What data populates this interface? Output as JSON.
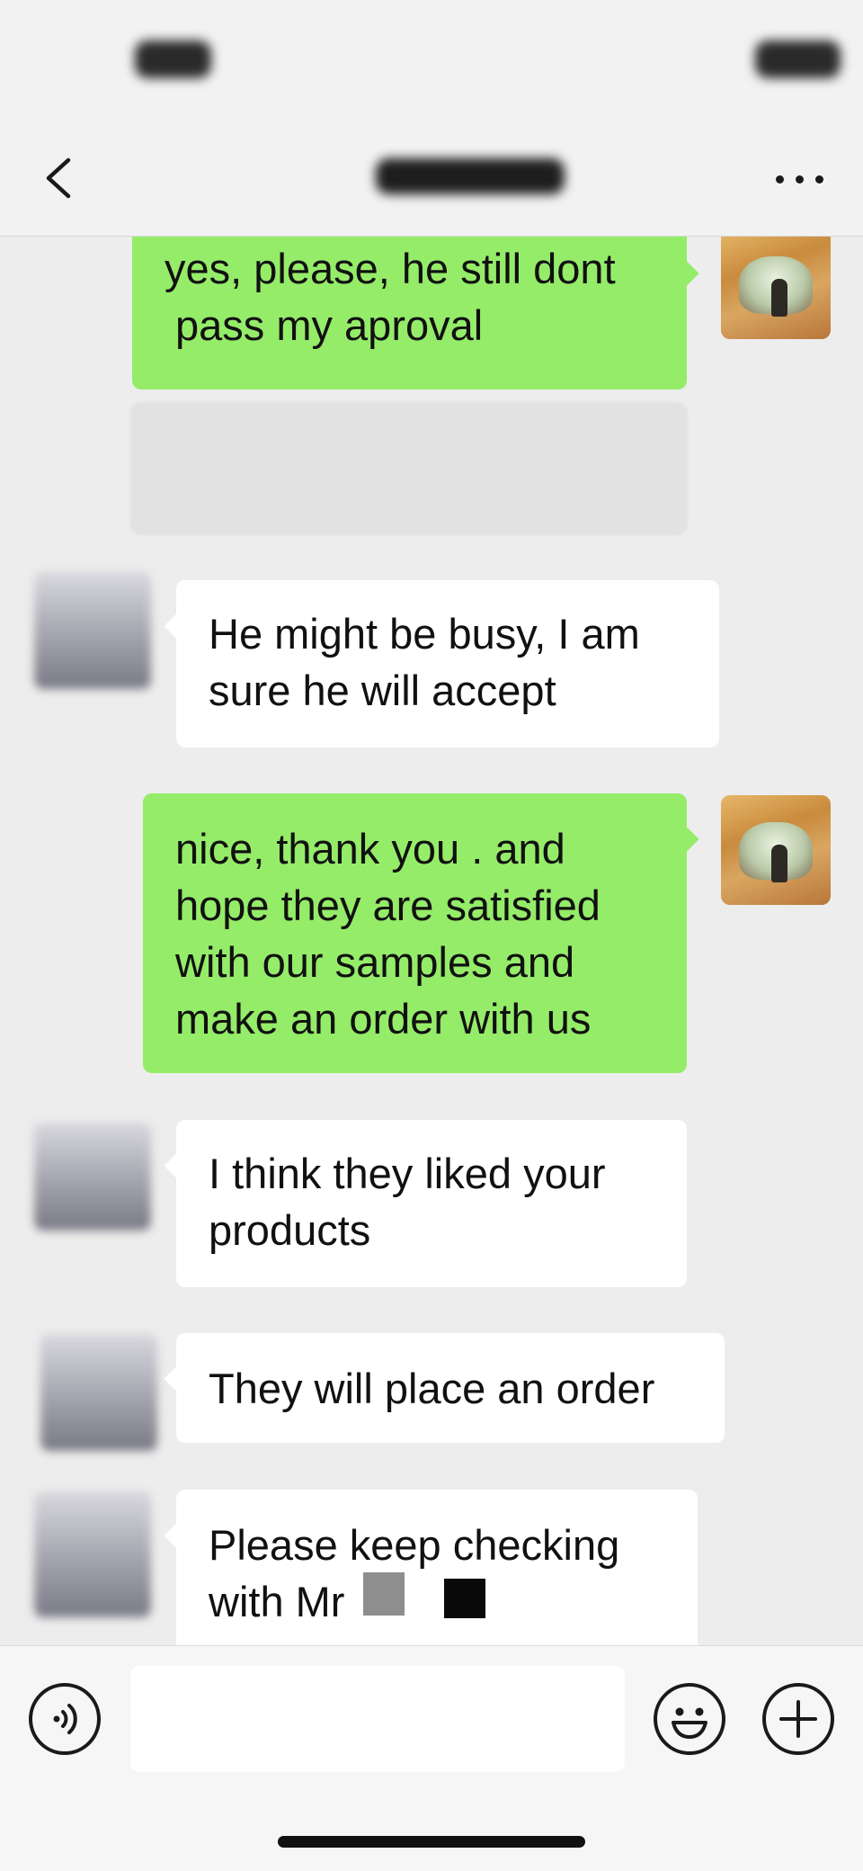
{
  "header": {
    "contact_name": "",
    "more_label": "More"
  },
  "messages": [
    {
      "id": 1,
      "side": "out",
      "lines": [
        "yes, please, he still dont",
        "pass my aproval"
      ]
    },
    {
      "id": 2,
      "side": "out",
      "type": "blurred-card"
    },
    {
      "id": 3,
      "side": "in",
      "lines": [
        "He might be busy, I am",
        "sure he will accept"
      ]
    },
    {
      "id": 4,
      "side": "out",
      "lines": [
        "nice, thank you . and",
        "hope they are satisfied",
        "with our samples and",
        "make an order with us"
      ]
    },
    {
      "id": 5,
      "side": "in",
      "lines": [
        "I think they liked your",
        "products"
      ]
    },
    {
      "id": 6,
      "side": "in",
      "lines": [
        "They will place an order"
      ]
    },
    {
      "id": 7,
      "side": "in",
      "lines": [
        "Please keep checking",
        "with Mr"
      ]
    }
  ],
  "input": {
    "value": "",
    "voice_icon": "voice-icon",
    "emoji_icon": "emoji-icon",
    "plus_icon": "plus-icon"
  },
  "colors": {
    "outgoing_bubble": "#95ec69",
    "incoming_bubble": "#ffffff",
    "chat_background": "#ededed"
  }
}
